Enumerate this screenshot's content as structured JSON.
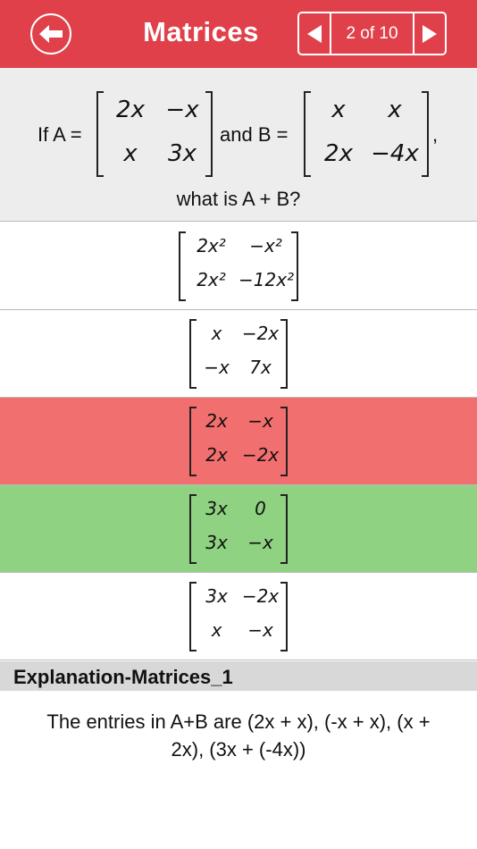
{
  "header": {
    "title": "Matrices",
    "pager_text": "2 of 10",
    "background_color": "#e0404a",
    "icons": {
      "back": "back-arrow-icon",
      "prev": "prev-triangle-icon",
      "next": "next-triangle-icon"
    }
  },
  "question": {
    "prefix": "If A =",
    "matrix_a": [
      [
        "2x",
        "−x"
      ],
      [
        "x",
        "3x"
      ]
    ],
    "connector": "and B =",
    "matrix_b": [
      [
        "x",
        "x"
      ],
      [
        "2x",
        "−4x"
      ]
    ],
    "suffix": ",",
    "line2": "what is A + B?"
  },
  "options": [
    {
      "state": "neutral",
      "matrix": [
        [
          "2x²",
          "−x²"
        ],
        [
          "2x²",
          "−12x²"
        ]
      ]
    },
    {
      "state": "neutral",
      "matrix": [
        [
          "x",
          "−2x"
        ],
        [
          "−x",
          "7x"
        ]
      ]
    },
    {
      "state": "wrong",
      "matrix": [
        [
          "2x",
          "−x"
        ],
        [
          "2x",
          "−2x"
        ]
      ]
    },
    {
      "state": "correct",
      "matrix": [
        [
          "3x",
          "0"
        ],
        [
          "3x",
          "−x"
        ]
      ]
    },
    {
      "state": "neutral",
      "matrix": [
        [
          "3x",
          "−2x"
        ],
        [
          "x",
          "−x"
        ]
      ]
    }
  ],
  "status_colors": {
    "wrong": "#f26f6f",
    "correct": "#8fd282"
  },
  "explanation": {
    "title": "Explanation-Matrices_1",
    "line1": "The entries in A+B are (2x + x), (-x + x), (x +",
    "line2": "2x), (3x + (-4x))"
  }
}
